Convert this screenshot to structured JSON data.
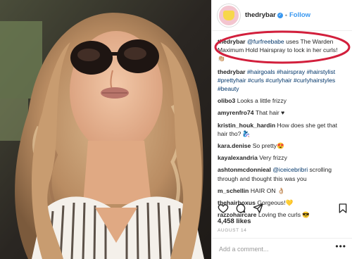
{
  "header": {
    "username": "thedrybar",
    "separator": "•",
    "follow_label": "Follow"
  },
  "caption": {
    "username": "thedrybar",
    "mention": "@furfreebabe",
    "text": " uses The Warden Maximum Hold Hairspray to lock in her curls! 👏🏼"
  },
  "hashtags": {
    "username": "thedrybar",
    "tags": "#hairgoals #hairspray #hairstylist #prettyhair #curls #curlyhair #curlyhairstyles #beauty"
  },
  "comments": [
    {
      "user": "olibo3",
      "text": "Looks a little frizzy"
    },
    {
      "user": "amyrenfro74",
      "text": "That hair ♥"
    },
    {
      "user": "kristin_houk_hardin",
      "text": "How does she get that hair tho? 🧞‍♀️"
    },
    {
      "user": "kara.denise",
      "text": "So pretty😍"
    },
    {
      "user": "kayalexandria",
      "text": "Very frizzy"
    },
    {
      "user": "ashtonmcdonnieal",
      "mention": "@iceicebribri",
      "text": " scrolling through and thought this was you"
    },
    {
      "user": "m_schellin",
      "text": "HAIR ON 👌🏼"
    },
    {
      "user": "thehairboxus",
      "text": "Gorgeous!💛"
    },
    {
      "user": "razzohaircare",
      "text": "Loving the curls 😎"
    }
  ],
  "actions": {
    "icons": [
      "heart-icon",
      "comment-icon",
      "share-icon",
      "bookmark-icon"
    ]
  },
  "likes_text": "4,458 likes",
  "date_text": "AUGUST 14",
  "add_comment": {
    "placeholder": "Add a comment..."
  },
  "more_label": "•••",
  "colors": {
    "link_blue": "#3897f0",
    "hashtag_navy": "#003569",
    "highlight_red": "#d21f3c",
    "verified_blue": "#3897f0"
  }
}
